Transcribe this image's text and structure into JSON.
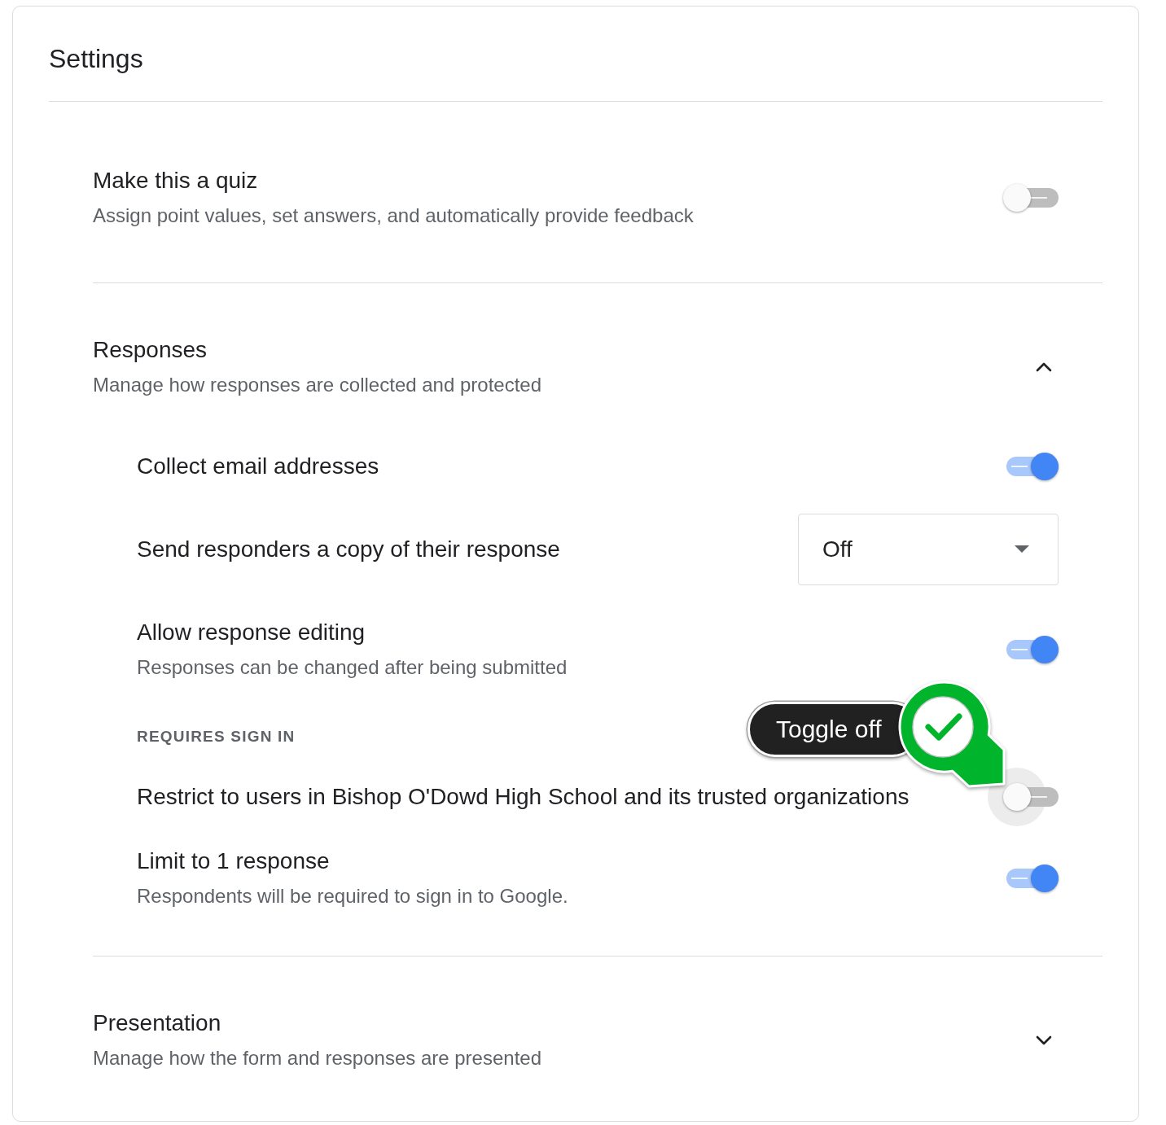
{
  "title": "Settings",
  "sections": [
    {
      "kind": "toggle",
      "title": "Make this a quiz",
      "description": "Assign point values, set answers, and automatically provide feedback",
      "on": false,
      "focused": false
    },
    {
      "kind": "expandable",
      "title": "Responses",
      "description": "Manage how responses are collected and protected",
      "expanded": true,
      "items": [
        {
          "kind": "toggle",
          "label": "Collect email addresses",
          "on": true,
          "focused": false
        },
        {
          "kind": "dropdown",
          "label": "Send responders a copy of their response",
          "value": "Off"
        },
        {
          "kind": "toggle",
          "label": "Allow response editing",
          "description": "Responses can be changed after being submitted",
          "on": true,
          "focused": false
        },
        {
          "kind": "heading",
          "label": "REQUIRES SIGN IN"
        },
        {
          "kind": "toggle",
          "label": "Restrict to users in Bishop O'Dowd High School and its trusted organizations",
          "on": false,
          "focused": true
        },
        {
          "kind": "toggle",
          "label": "Limit to 1 response",
          "description": "Respondents will be required to sign in to Google.",
          "on": true,
          "focused": false
        }
      ]
    },
    {
      "kind": "expandable",
      "title": "Presentation",
      "description": "Manage how the form and responses are presented",
      "expanded": false
    }
  ],
  "callout": {
    "label": "Toggle off"
  }
}
